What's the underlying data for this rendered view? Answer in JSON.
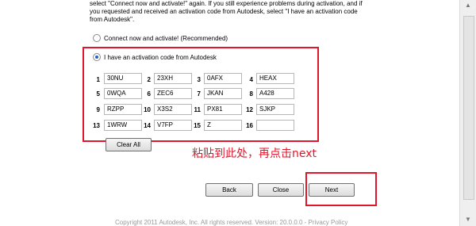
{
  "intro": {
    "line1": "select \"Connect now and activate!\" again. If you still experience problems during activation, and if",
    "line2": "you requested and received an activation code from Autodesk, select \"I have an activation code",
    "line3": "from Autodesk\"."
  },
  "options": {
    "connect_label": "Connect now and activate! (Recommended)",
    "code_label": "I have an activation code from Autodesk"
  },
  "codes": [
    {
      "n": "1",
      "v": "30NU"
    },
    {
      "n": "2",
      "v": "23XH"
    },
    {
      "n": "3",
      "v": "0AFX"
    },
    {
      "n": "4",
      "v": "HEAX"
    },
    {
      "n": "5",
      "v": "0WQA"
    },
    {
      "n": "6",
      "v": "ZEC6"
    },
    {
      "n": "7",
      "v": "JKAN"
    },
    {
      "n": "8",
      "v": "A428"
    },
    {
      "n": "9",
      "v": "RZPP"
    },
    {
      "n": "10",
      "v": "X3S2"
    },
    {
      "n": "11",
      "v": "PX81"
    },
    {
      "n": "12",
      "v": "SJKP"
    },
    {
      "n": "13",
      "v": "1WRW"
    },
    {
      "n": "14",
      "v": "V7FP"
    },
    {
      "n": "15",
      "v": "Z"
    },
    {
      "n": "16",
      "v": ""
    }
  ],
  "buttons": {
    "clear_all": "Clear All",
    "back": "Back",
    "close": "Close",
    "next": "Next"
  },
  "hint": "粘贴到此处，再点击next",
  "footer": "Copyright 2011 Autodesk, Inc. All rights reserved. Version: 20.0.0.0 - Privacy Policy",
  "colors": {
    "annotation": "#e0162b",
    "selected_radio": "#2060c0"
  }
}
